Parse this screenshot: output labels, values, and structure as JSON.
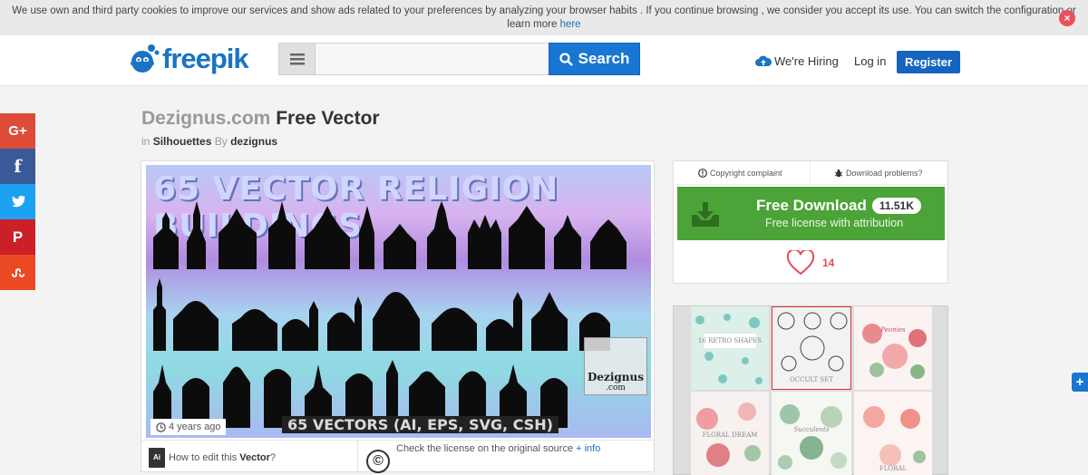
{
  "cookie_bar": {
    "text": "We use own and third party cookies to improve our services and show ads related to your preferences by analyzing your browser habits . If you continue browsing , we consider you accept its use. You can switch the configuration or learn more",
    "link": "here",
    "close": "×"
  },
  "header": {
    "logo_text": "freepik",
    "search_placeholder": "",
    "search_button": "Search",
    "hiring": "We're Hiring",
    "login": "Log in",
    "register": "Register",
    "brand_color": "#1a74c4"
  },
  "social": [
    {
      "label": "G+",
      "icon": "google-plus-icon",
      "color": "#dd4b39"
    },
    {
      "label": "f",
      "icon": "facebook-icon",
      "color": "#3b5998"
    },
    {
      "label": "",
      "icon": "twitter-icon",
      "color": "#1da1f2"
    },
    {
      "label": "P",
      "icon": "pinterest-icon",
      "color": "#cb2027"
    },
    {
      "label": "",
      "icon": "stumbleupon-icon",
      "color": "#eb4924"
    }
  ],
  "resource": {
    "source": "Dezignus.com",
    "title_rest": "Free Vector",
    "in_label": "in",
    "category": "Silhouettes",
    "by_label": "By",
    "author": "dezignus",
    "art_title": "65 VECTOR RELIGION BUILDINGS",
    "art_footer": "65 VECTORS (AI, EPS, SVG, CSH)",
    "watermark": "Dezignus",
    "watermark_sub": ".com",
    "age": "4 years ago",
    "edit_prefix": "How to edit this",
    "edit_type": "Vector",
    "edit_suffix": "?",
    "license_text": "Check the license on the original source",
    "license_link": "+ info",
    "license_symbol": "©"
  },
  "download": {
    "copyright": "Copyright complaint",
    "problems": "Download problems?",
    "button_title": "Free Download",
    "count": "11.51K",
    "subtitle": "Free license with attribution",
    "likes": "14",
    "green": "#4ca337"
  },
  "ad": {
    "tiles": [
      "16 RETRO SHAPES",
      "OCCULT SET",
      "Peonies",
      "FLORAL DREAM",
      "Succulents",
      "FLORAL"
    ]
  },
  "floating": {
    "label": "+"
  }
}
